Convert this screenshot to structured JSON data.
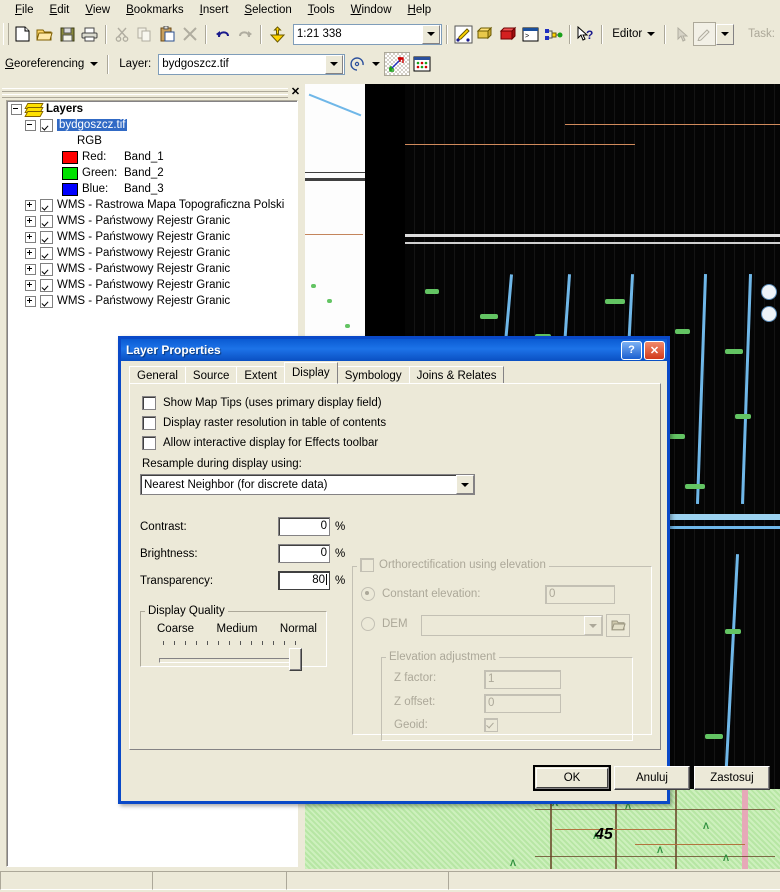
{
  "app": {
    "menu": [
      "File",
      "Edit",
      "View",
      "Bookmarks",
      "Insert",
      "Selection",
      "Tools",
      "Window",
      "Help"
    ],
    "toolbar": {
      "icons": [
        "new-document-icon",
        "open-folder-icon",
        "save-icon",
        "print-icon",
        "cut-icon",
        "copy-icon",
        "paste-icon",
        "delete-icon",
        "undo-icon",
        "redo-icon",
        "add-data-icon"
      ],
      "scale_value": "1:21 338",
      "right_icons": [
        "editor-toolbar-icon",
        "map-toolbar-icon",
        "toolbox-icon",
        "command-window-icon",
        "model-builder-icon",
        "whats-this-help-icon"
      ],
      "editor_label": "Editor",
      "task_label": "Task:"
    },
    "georeferencing": {
      "menu_label": "Georeferencing",
      "layer_label": "Layer:",
      "layer_value": "bydgoszcz.tif",
      "icons": [
        "rotate-icon",
        "dropdown-arrow-icon",
        "add-control-points-icon",
        "view-link-table-icon"
      ]
    }
  },
  "toc": {
    "close_label": "✕",
    "root": "Layers",
    "raster": {
      "name": "bydgoszcz.tif",
      "mode": "RGB",
      "bands": [
        {
          "channel": "Red:",
          "band": "Band_1",
          "color": "#FF0000"
        },
        {
          "channel": "Green:",
          "band": "Band_2",
          "color": "#00E000"
        },
        {
          "channel": "Blue:",
          "band": "Band_3",
          "color": "#0000FF"
        }
      ]
    },
    "wms_layers": [
      "WMS - Rastrowa Mapa Topograficzna Polski",
      "WMS - Państwowy Rejestr Granic",
      "WMS - Państwowy Rejestr Granic",
      "WMS - Państwowy Rejestr Granic",
      "WMS - Państwowy Rejestr Granic",
      "WMS - Państwowy Rejestr Granic",
      "WMS - Państwowy Rejestr Granic"
    ]
  },
  "map": {
    "label_number": "45"
  },
  "dialog": {
    "title": "Layer Properties",
    "help_label": "?",
    "close_label": "✕",
    "tabs": [
      {
        "label": "General",
        "active": false
      },
      {
        "label": "Source",
        "active": false
      },
      {
        "label": "Extent",
        "active": false
      },
      {
        "label": "Display",
        "active": true
      },
      {
        "label": "Symbology",
        "active": false
      },
      {
        "label": "Joins & Relates",
        "active": false
      }
    ],
    "display": {
      "checkboxes": [
        {
          "label": "Show Map Tips (uses primary display field)",
          "checked": false
        },
        {
          "label": "Display raster resolution in table of contents",
          "checked": false
        },
        {
          "label": "Allow interactive display for Effects toolbar",
          "checked": false
        }
      ],
      "resample_label": "Resample during display using:",
      "resample_value": "Nearest Neighbor (for discrete data)",
      "fields": [
        {
          "label": "Contrast:",
          "value": "0",
          "unit": "%"
        },
        {
          "label": "Brightness:",
          "value": "0",
          "unit": "%"
        },
        {
          "label": "Transparency:",
          "value": "80",
          "unit": "%"
        }
      ],
      "quality": {
        "legend": "Display Quality",
        "marks": [
          "Coarse",
          "Medium",
          "Normal"
        ],
        "position": "Normal"
      },
      "ortho": {
        "legend": "Orthorectification using elevation",
        "enabled": false,
        "constant_elevation_label": "Constant elevation:",
        "constant_elevation_value": "0",
        "constant_selected": true,
        "dem_label": "DEM",
        "dem_value": "",
        "browse_icon": "open-folder-icon",
        "adjust_legend": "Elevation adjustment",
        "z_factor_label": "Z factor:",
        "z_factor_value": "1",
        "z_offset_label": "Z offset:",
        "z_offset_value": "0",
        "geoid_label": "Geoid:",
        "geoid_checked": true
      }
    },
    "buttons": [
      {
        "label": "OK",
        "default": true
      },
      {
        "label": "Anuluj",
        "default": false
      },
      {
        "label": "Zastosuj",
        "default": false
      }
    ]
  }
}
